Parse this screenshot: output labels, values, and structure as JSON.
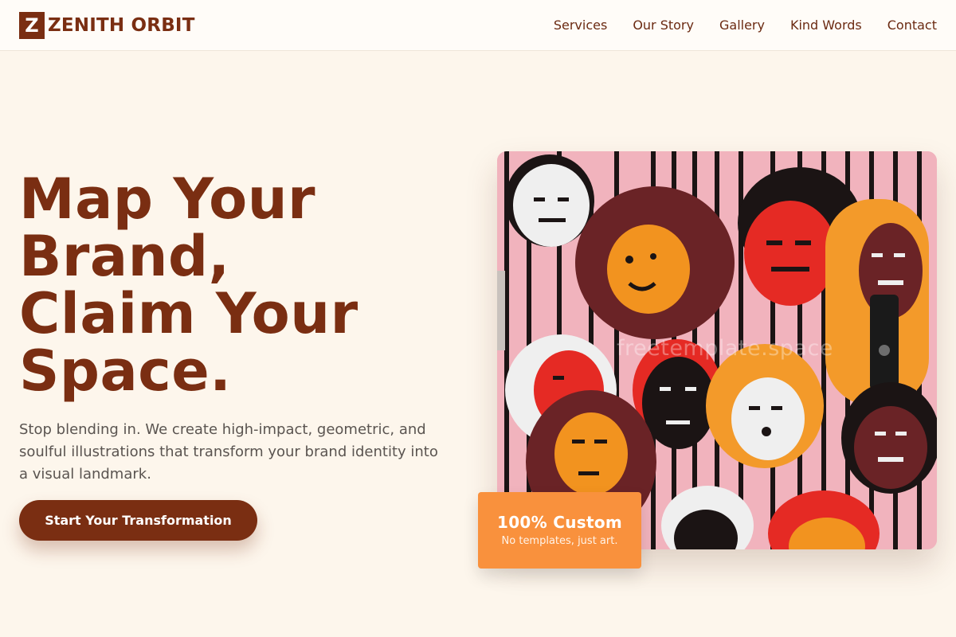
{
  "brand": {
    "logo_letter": "Z",
    "name": "ZENITH ORBIT"
  },
  "nav": {
    "items": [
      {
        "label": "Services"
      },
      {
        "label": "Our Story"
      },
      {
        "label": "Gallery"
      },
      {
        "label": "Kind Words"
      },
      {
        "label": "Contact"
      }
    ]
  },
  "hero": {
    "title_lines": [
      "Map Your",
      "Brand,",
      "Claim Your",
      "Space."
    ],
    "subtitle": "Stop blending in. We create high-impact, geometric, and soulful illustrations that transform your brand identity into a visual landmark.",
    "cta_label": "Start Your Transformation",
    "image": {
      "watermark": "freetemplate.space",
      "subject": "mural-of-illustrated-faces"
    }
  },
  "badge": {
    "title": "100% Custom",
    "subtitle": "No templates, just art."
  },
  "colors": {
    "primary": "#7a2e12",
    "background": "#fdf6ec",
    "header_background": "#fffcf8",
    "accent": "#f9913d",
    "body_text": "#5a5450"
  }
}
